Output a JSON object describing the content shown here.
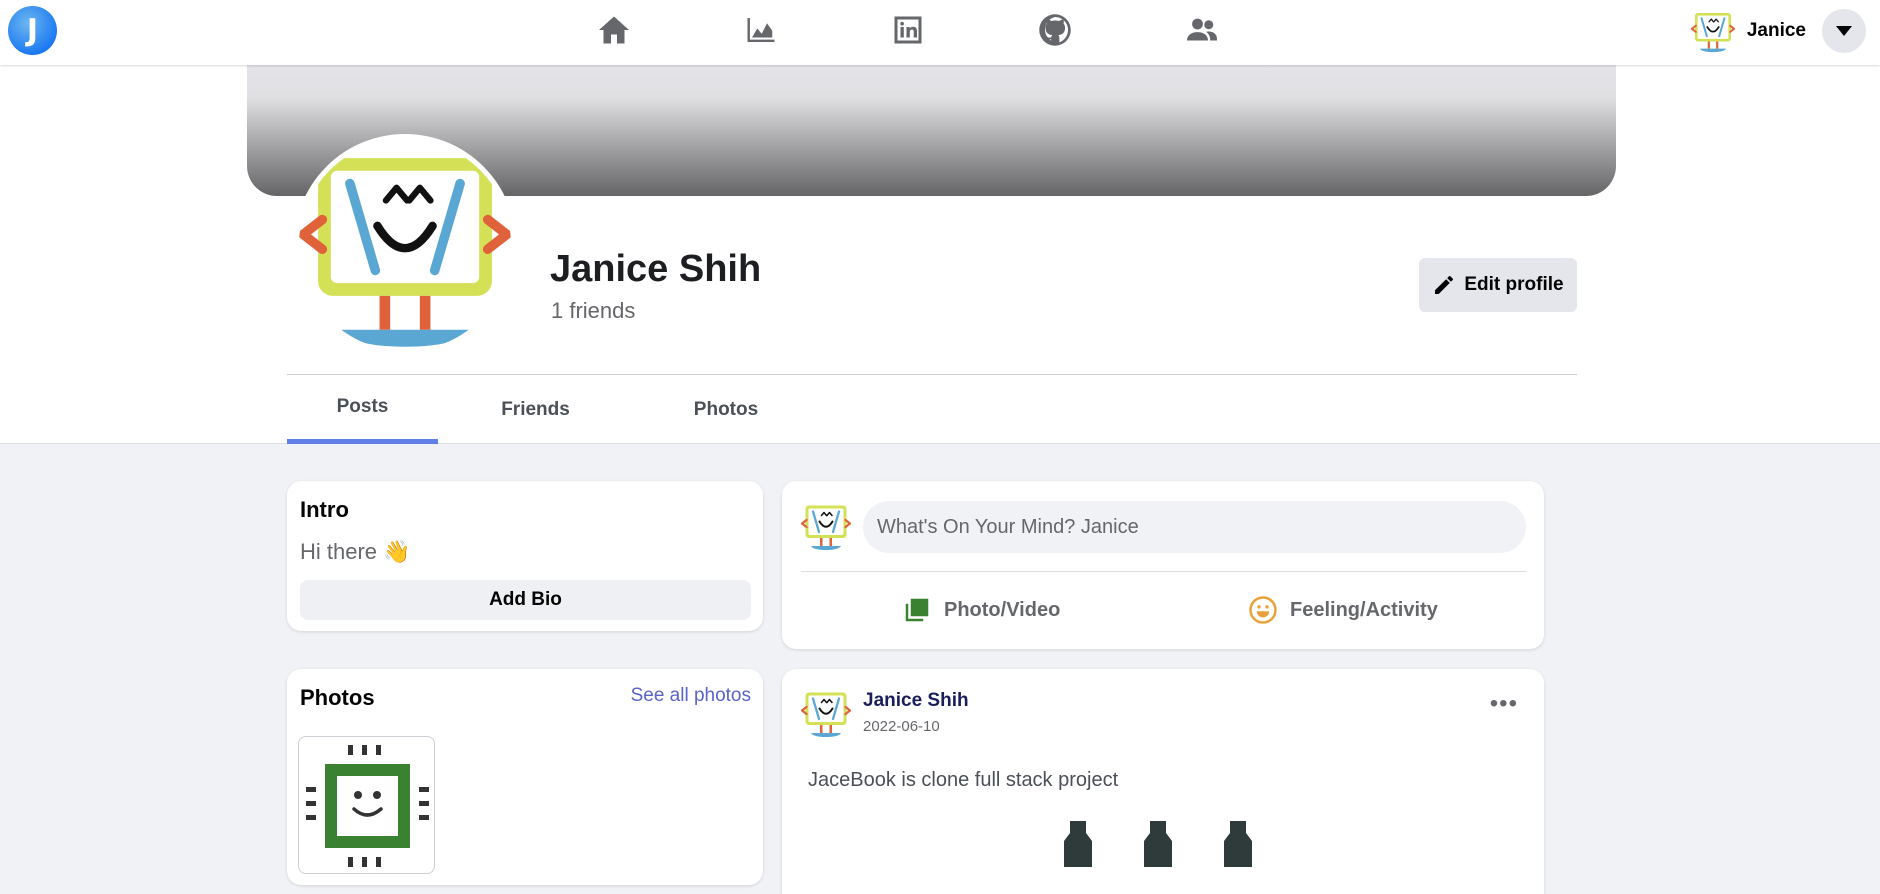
{
  "nav": {
    "logo_letter": "J",
    "icons": [
      "home-icon",
      "chart-icon",
      "linkedin-icon",
      "github-icon",
      "friends-icon"
    ],
    "user_name": "Janice"
  },
  "profile": {
    "name": "Janice Shih",
    "friends": "1 friends",
    "edit_label": "Edit profile",
    "tabs": [
      {
        "label": "Posts",
        "active": true
      },
      {
        "label": "Friends",
        "active": false
      },
      {
        "label": "Photos",
        "active": false
      }
    ]
  },
  "intro": {
    "title": "Intro",
    "bio": "Hi there",
    "bio_emoji": "👋",
    "add_bio_label": "Add Bio"
  },
  "photos": {
    "title": "Photos",
    "see_all": "See all photos"
  },
  "composer": {
    "placeholder": "What's On Your Mind? Janice",
    "photo_label": "Photo/Video",
    "feeling_label": "Feeling/Activity"
  },
  "post": {
    "author": "Janice Shih",
    "date": "2022-06-10",
    "text": "JaceBook is clone full stack project"
  },
  "colors": {
    "accent": "#6080e8",
    "link": "#5864c8",
    "photo_green": "#3b8132",
    "feeling_orange": "#e9a23b"
  }
}
